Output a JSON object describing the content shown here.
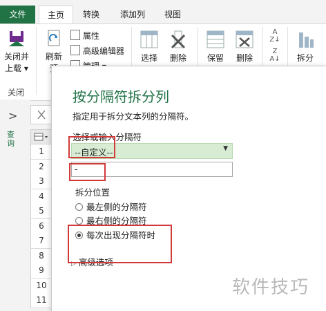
{
  "tabs": {
    "file": "文件",
    "home": "主页",
    "transform": "转换",
    "add_column": "添加列",
    "view": "视图"
  },
  "ribbon": {
    "close_load_line1": "关闭并",
    "close_load_line2": "上载",
    "close_group": "关闭",
    "refresh_line1": "刷新",
    "refresh_line2": "预",
    "properties": "属性",
    "advanced_editor": "高级编辑器",
    "manage": "管理",
    "choose": "选择",
    "delete": "删除",
    "keep": "保留",
    "remove": "删除",
    "split": "拆分"
  },
  "left": {
    "chevron": ">",
    "query_label": "查询"
  },
  "grid": {
    "rows": [
      "1",
      "2",
      "3",
      "4",
      "5",
      "6",
      "7",
      "8",
      "9",
      "10",
      "11"
    ]
  },
  "dialog": {
    "title": "按分隔符拆分列",
    "subtitle": "指定用于拆分文本列的分隔符。",
    "select_label": "选择或输入分隔符",
    "dropdown_value": "--自定义--",
    "delimiter_value": "-",
    "split_position_label": "拆分位置",
    "options": [
      {
        "label": "最左侧的分隔符",
        "selected": false
      },
      {
        "label": "最右侧的分隔符",
        "selected": false
      },
      {
        "label": "每次出现分隔符时",
        "selected": true
      }
    ],
    "advanced": "高级选项"
  },
  "watermark": "软件技巧",
  "colors": {
    "accent": "#217346",
    "highlight": "#d23a3a",
    "dropdown_bg": "#d8ecd4"
  }
}
